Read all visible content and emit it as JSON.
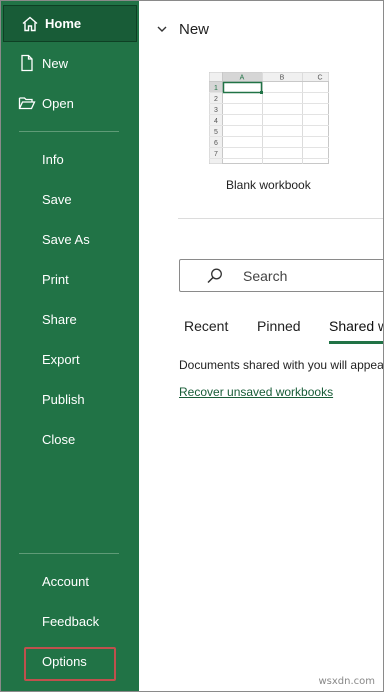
{
  "sidebar": {
    "home_label": "Home",
    "new_label": "New",
    "open_label": "Open",
    "items": [
      "Info",
      "Save",
      "Save As",
      "Print",
      "Share",
      "Export",
      "Publish",
      "Close"
    ],
    "account_label": "Account",
    "feedback_label": "Feedback",
    "options_label": "Options",
    "background_color": "#217346",
    "selected_color": "#185c37",
    "highlight_color": "#c0504d"
  },
  "main": {
    "section_title": "New",
    "template": {
      "caption": "Blank workbook",
      "columns": [
        "A",
        "B",
        "C"
      ],
      "rows": [
        "1",
        "2",
        "3",
        "4",
        "5",
        "6",
        "7"
      ]
    },
    "search": {
      "placeholder": "Search"
    },
    "tabs": [
      "Recent",
      "Pinned",
      "Shared with Me"
    ],
    "active_tab": "Shared with Me",
    "shared_message": "Documents shared with you will appear here.",
    "recover_link": "Recover unsaved workbooks",
    "accent_color": "#217346"
  },
  "watermark": "wsxdn.com"
}
